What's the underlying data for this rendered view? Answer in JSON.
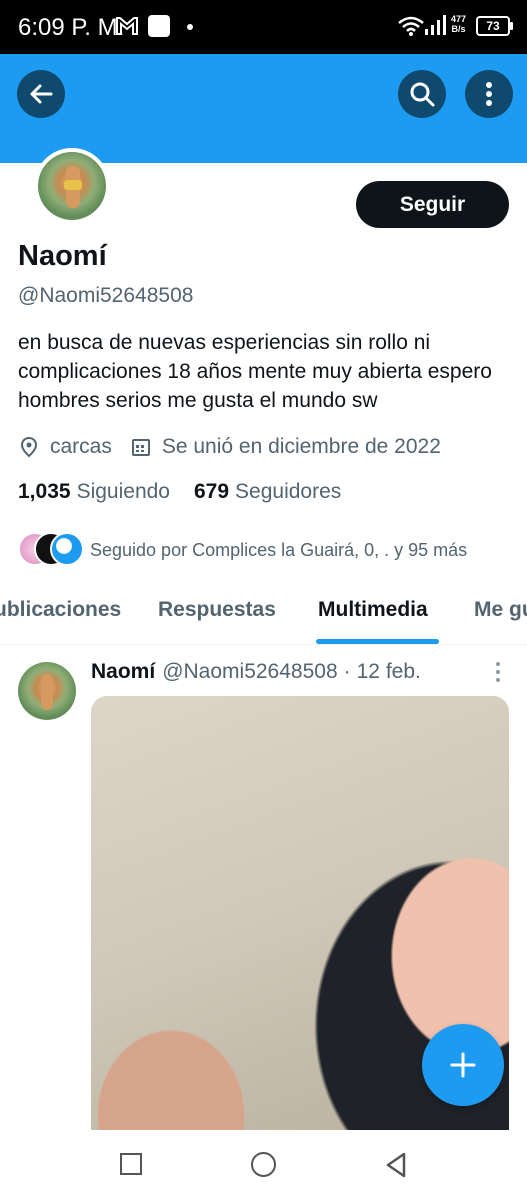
{
  "status_bar": {
    "time": "6:09 P. M.",
    "net_speed_value": "477",
    "net_speed_unit": "B/s",
    "battery": "73"
  },
  "header": {
    "back_icon": "arrow-left-icon",
    "search_icon": "search-icon",
    "more_icon": "more-vertical-icon",
    "banner_color": "#1d9bf0"
  },
  "profile": {
    "follow_label": "Seguir",
    "name": "Naomí",
    "handle": "@Naomi52648508",
    "bio": "en busca de nuevas esperiencias sin rollo ni complicaciones 18 años  mente muy abierta espero hombres serios me gusta el mundo sw",
    "location": "carcas",
    "joined": "Se unió en diciembre de 2022",
    "following_count": "1,035",
    "following_label": "Siguiendo",
    "followers_count": "679",
    "followers_label": "Seguidores",
    "followed_by": "Seguido por Complices la Guairá, 0, . y 95 más"
  },
  "tabs": [
    {
      "label": "Publicaciones"
    },
    {
      "label": "Respuestas"
    },
    {
      "label": "Multimedia",
      "active": true
    },
    {
      "label": "Me gusta"
    }
  ],
  "tab_visible_text": {
    "t1": "ublicaciones",
    "t4": "Me gu"
  },
  "post": {
    "name": "Naomí",
    "handle": "@Naomi52648508",
    "separator": "·",
    "date": "12 feb."
  },
  "fab": {
    "icon": "plus-icon"
  },
  "accent": "#1d9bf0"
}
